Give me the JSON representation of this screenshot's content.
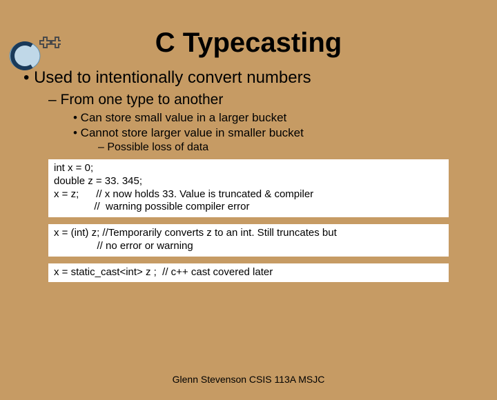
{
  "title": "C Typecasting",
  "bullets": {
    "b1": "•  Used to intentionally convert numbers",
    "b2": "–  From one type to another",
    "b3a": "•  Can store small value in a larger bucket",
    "b3b": "•  Cannot store larger value in smaller bucket",
    "b4": "–  Possible loss of data"
  },
  "code1": "int x = 0;\ndouble z = 33. 345;\nx = z;      // x now holds 33. Value is truncated & compiler\n              //  warning possible compiler error",
  "code2": "x = (int) z; //Temporarily converts z to an int. Still truncates but\n               // no error or warning",
  "code3": "x = static_cast<int> z ;  // c++ cast covered later",
  "footer": "Glenn Stevenson CSIS 113A MSJC"
}
